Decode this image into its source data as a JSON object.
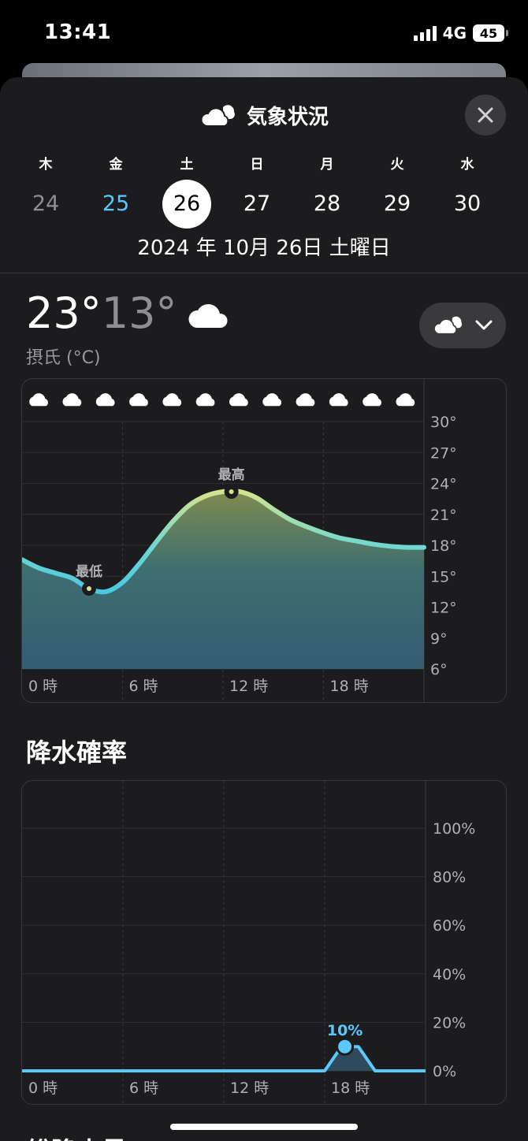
{
  "status": {
    "time": "13:41",
    "network": "4G",
    "battery": "45"
  },
  "header": {
    "title": "気象状況",
    "icon": "cloud-icon",
    "close_icon": "close-icon"
  },
  "days": [
    {
      "name": "木",
      "num": "24",
      "state": "past"
    },
    {
      "name": "金",
      "num": "25",
      "state": "today"
    },
    {
      "name": "土",
      "num": "26",
      "state": "selected"
    },
    {
      "name": "日",
      "num": "27",
      "state": "normal"
    },
    {
      "name": "月",
      "num": "28",
      "state": "normal"
    },
    {
      "name": "火",
      "num": "29",
      "state": "normal"
    },
    {
      "name": "水",
      "num": "30",
      "state": "normal"
    }
  ],
  "date_line": "2024 年 10月 26日 土曜日",
  "summary": {
    "high": "23°",
    "low": "13°",
    "unit": "摂氏 (°C)",
    "condition_icon": "cloud-icon"
  },
  "picker": {
    "icon": "cloud-icon",
    "chevron": "chevron-down-icon"
  },
  "temp_chart": {
    "min_label": "最低",
    "max_label": "最高",
    "min_at_hour": 4,
    "max_at_hour": 12.5,
    "hour_icons": [
      "cloud-icon",
      "cloud-icon",
      "cloud-icon",
      "cloud-icon",
      "cloud-icon",
      "cloud-icon",
      "cloud-icon",
      "cloud-icon",
      "cloud-icon",
      "cloud-icon",
      "cloud-icon",
      "cloud-icon"
    ]
  },
  "precip": {
    "title": "降水確率",
    "peak_label": "10%"
  },
  "next_section_title": "総降水量",
  "colors": {
    "sheet_bg": "#1c1c1e",
    "accent_blue": "#5ac8fa",
    "grey_text": "#8e8e93"
  },
  "chart_data": [
    {
      "type": "area",
      "x": [
        0,
        1,
        2,
        3,
        4,
        5,
        6,
        7,
        8,
        9,
        10,
        11,
        12,
        13,
        14,
        15,
        16,
        17,
        18,
        19,
        20,
        21,
        22,
        23,
        24
      ],
      "values": [
        16.6,
        15.8,
        15.3,
        14.8,
        13.8,
        13.5,
        14.4,
        16.2,
        18.3,
        20.3,
        21.9,
        22.8,
        23.2,
        23.2,
        22.6,
        21.5,
        20.5,
        19.8,
        19.2,
        18.7,
        18.4,
        18.1,
        17.9,
        17.8,
        17.8
      ],
      "xlabel": "",
      "ylabel": "",
      "x_ticks": [
        "0 時",
        "6 時",
        "12 時",
        "18 時"
      ],
      "x_tick_values": [
        0,
        6,
        12,
        18
      ],
      "y_ticks": [
        "30°",
        "27°",
        "24°",
        "21°",
        "18°",
        "15°",
        "12°",
        "9°",
        "6°"
      ],
      "y_tick_values": [
        30,
        27,
        24,
        21,
        18,
        15,
        12,
        9,
        6
      ],
      "ylim": [
        6,
        30
      ],
      "xlim": [
        0,
        24
      ],
      "grid": true
    },
    {
      "type": "line",
      "x": [
        0,
        6,
        12,
        18,
        19,
        20,
        21,
        22,
        23,
        24
      ],
      "values": [
        0,
        0,
        0,
        0,
        10,
        10,
        0,
        0,
        0,
        0
      ],
      "xlabel": "",
      "ylabel": "",
      "x_ticks": [
        "0 時",
        "6 時",
        "12 時",
        "18 時"
      ],
      "x_tick_values": [
        0,
        6,
        12,
        18
      ],
      "y_ticks": [
        "100%",
        "80%",
        "60%",
        "40%",
        "20%",
        "0%"
      ],
      "y_tick_values": [
        100,
        80,
        60,
        40,
        20,
        0
      ],
      "ylim": [
        0,
        100
      ],
      "xlim": [
        0,
        24
      ],
      "grid": true
    }
  ]
}
